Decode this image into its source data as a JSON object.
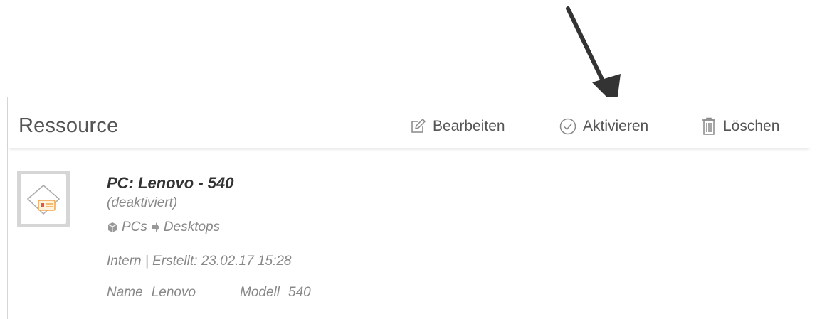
{
  "panel": {
    "title": "Ressource",
    "actions": {
      "edit": {
        "label": "Bearbeiten",
        "icon": "edit-icon"
      },
      "activate": {
        "label": "Aktivieren",
        "icon": "check-circle-icon"
      },
      "delete": {
        "label": "Löschen",
        "icon": "trash-icon"
      }
    }
  },
  "annotation": {
    "icon": "arrow-pointer-icon",
    "color": "#333333"
  },
  "resource": {
    "title": "PC: Lenovo - 540",
    "status": "(deaktiviert)",
    "path": [
      "PCs",
      "Desktops"
    ],
    "meta": "Intern | Erstellt: 23.02.17 15:28",
    "attributes": [
      {
        "key": "Name",
        "value": "Lenovo"
      },
      {
        "key": "Modell",
        "value": "540"
      }
    ],
    "thumbnail_icon": "resource-tag-icon",
    "thumbnail_accent": "#f0a64a"
  }
}
